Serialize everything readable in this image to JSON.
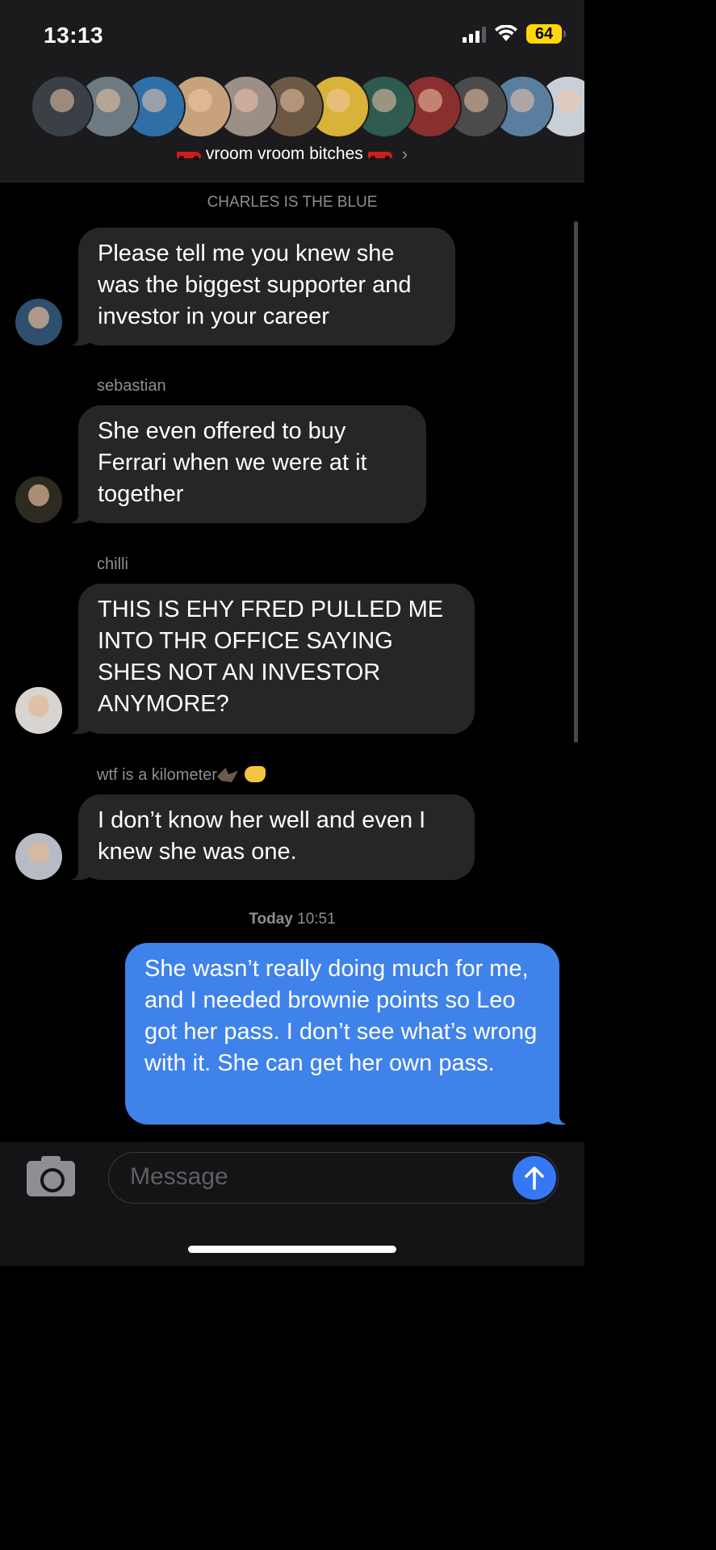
{
  "status_bar": {
    "time": "13:13",
    "battery": "64"
  },
  "group": {
    "name": "vroom vroom bitches",
    "avatar_colors": [
      "#3b3f46",
      "#6e7a82",
      "#2f6fa8",
      "#c7a27d",
      "#9b8f86",
      "#6c5844",
      "#d9b23a",
      "#2e5a4f",
      "#8a2f2f",
      "#4b4b4b",
      "#5a7f9e",
      "#c9cfd6"
    ]
  },
  "messages": [
    {
      "type": "system",
      "text": "CHARLES IS THE BLUE"
    },
    {
      "type": "in",
      "sender": "",
      "text": "Please tell me you knew she was the biggest supporter and investor in your career",
      "avatar_color": "#2f4f6f"
    },
    {
      "type": "in",
      "sender": "sebastian",
      "text": "She even offered to buy Ferrari when we were at it together",
      "avatar_color": "#2d2a22"
    },
    {
      "type": "in",
      "sender": "chilli",
      "text": "THIS IS EHY FRED PULLED ME INTO THR OFFICE SAYING SHES NOT AN INVESTOR ANYMORE?",
      "avatar_color": "#d8d4cf"
    },
    {
      "type": "in",
      "sender": "wtf is a kilometer",
      "text": "I don’t know her well and even I knew she was one.",
      "avatar_color": "#b7bcc4"
    },
    {
      "type": "timestamp",
      "day": "Today",
      "time": "10:51"
    },
    {
      "type": "out",
      "text": "She wasn’t really doing much for me, and I needed brownie points so Leo got her pass. I don’t see what’s wrong with it. She can get her own pass."
    }
  ],
  "composer": {
    "placeholder": "Message"
  },
  "icons": {
    "camera": "camera-icon",
    "send": "arrow-up-icon",
    "signal": "cellular-signal-icon",
    "wifi": "wifi-icon",
    "chevron": "chevron-right-icon"
  },
  "colors": {
    "outgoing_bubble": "#3f82ea",
    "incoming_bubble": "#262628",
    "send_button": "#3478f6"
  }
}
